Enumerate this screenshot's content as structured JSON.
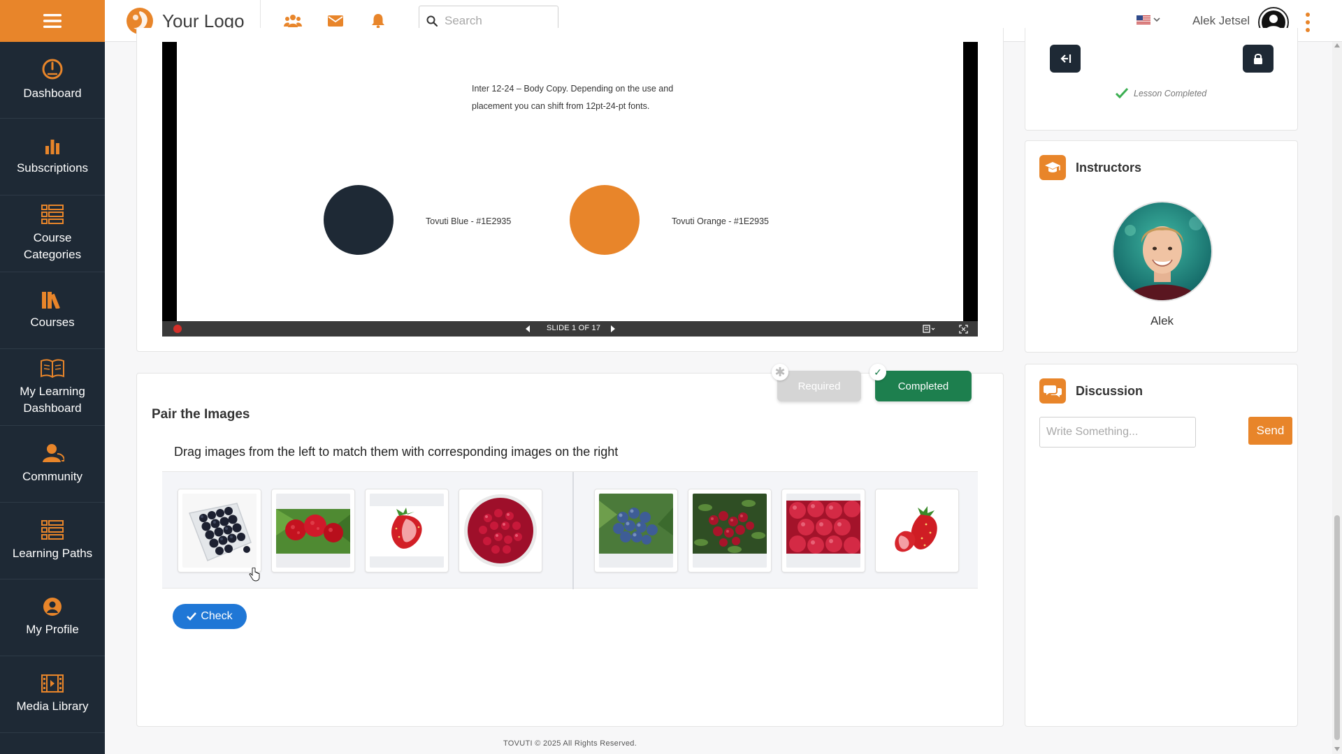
{
  "header": {
    "logo_text": "Your Logo",
    "search_placeholder": "Search",
    "search_value": "",
    "language": "en-US",
    "user_name": "Alek Jetsel"
  },
  "sidebar": {
    "items": [
      {
        "label": "Dashboard",
        "icon": "gauge-icon"
      },
      {
        "label": "Subscriptions",
        "icon": "bar-chart-icon"
      },
      {
        "label": "Course Categories",
        "icon": "list-icon"
      },
      {
        "label": "Courses",
        "icon": "books-icon"
      },
      {
        "label": "My Learning Dashboard",
        "icon": "open-book-icon"
      },
      {
        "label": "Community",
        "icon": "user-group-icon"
      },
      {
        "label": "Learning Paths",
        "icon": "list-icon"
      },
      {
        "label": "My Profile",
        "icon": "user-circle-icon"
      },
      {
        "label": "Media Library",
        "icon": "film-icon"
      }
    ]
  },
  "slide": {
    "body_text": "Inter 12-24 – Body Copy. Depending on the use and placement you can shift from 12pt-24-pt fonts.",
    "swatches": [
      {
        "label": "Tovuti Blue - #1E2935",
        "color": "#1E2935"
      },
      {
        "label": "Tovuti Orange - #1E2935",
        "color": "#E8852A"
      }
    ],
    "counter": "SLIDE 1 OF 17"
  },
  "activity": {
    "title": "Pair the Images",
    "instruction": "Drag images from the left to match them with corresponding images on the right",
    "required_label": "Required",
    "completed_label": "Completed",
    "left_images": [
      "blueberries-in-box",
      "raspberries-on-plant",
      "strawberry-half",
      "pomegranate-seeds-bowl"
    ],
    "right_images": [
      "blueberries-on-bush",
      "cranberries-on-plant",
      "raspberries-pile",
      "strawberries"
    ],
    "check_label": "Check"
  },
  "lesson": {
    "status": "Lesson Completed"
  },
  "instructors": {
    "title": "Instructors",
    "name": "Alek"
  },
  "discussion": {
    "title": "Discussion",
    "placeholder": "Write Something...",
    "send_label": "Send"
  },
  "footer": {
    "text": "TOVUTI © 2025 All Rights Reserved."
  },
  "colors": {
    "accent": "#E8852A",
    "navy": "#1E2935",
    "success": "#1D7F4E",
    "primary": "#1F77D6"
  }
}
